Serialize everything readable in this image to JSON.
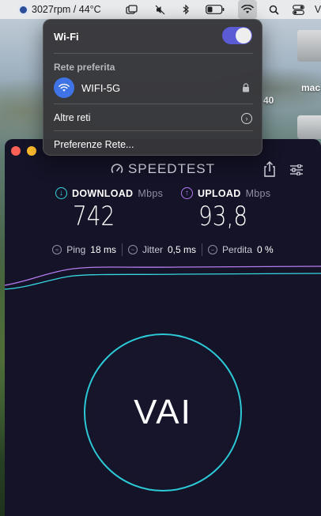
{
  "menubar": {
    "temp_text": "3027rpm / 44°C",
    "icons": [
      "fan-icon",
      "window-icon",
      "mute-icon",
      "bluetooth-icon",
      "battery-icon",
      "wifi-icon",
      "search-icon",
      "control-center-icon"
    ]
  },
  "desktop": {
    "label_top": "mac",
    "label_num": "40"
  },
  "wifi_menu": {
    "title": "Wi-Fi",
    "toggle_on": true,
    "preferred_section": "Rete preferita",
    "network_name": "WIFI-5G",
    "other_networks": "Altre reti",
    "network_prefs": "Preferenze Rete..."
  },
  "speedtest": {
    "logo": "SPEEDTEST",
    "download_label": "DOWNLOAD",
    "download_unit": "Mbps",
    "download_value": "742",
    "upload_label": "UPLOAD",
    "upload_unit": "Mbps",
    "upload_value": "93,8",
    "ping_label": "Ping",
    "ping_value": "18 ms",
    "jitter_label": "Jitter",
    "jitter_value": "0,5 ms",
    "loss_label": "Perdita",
    "loss_value": "0 %",
    "go_label": "VAI"
  },
  "colors": {
    "download": "#36d6e0",
    "upload": "#b57cf0",
    "window_bg": "#141327",
    "toggle_on": "#5b5bd6"
  }
}
